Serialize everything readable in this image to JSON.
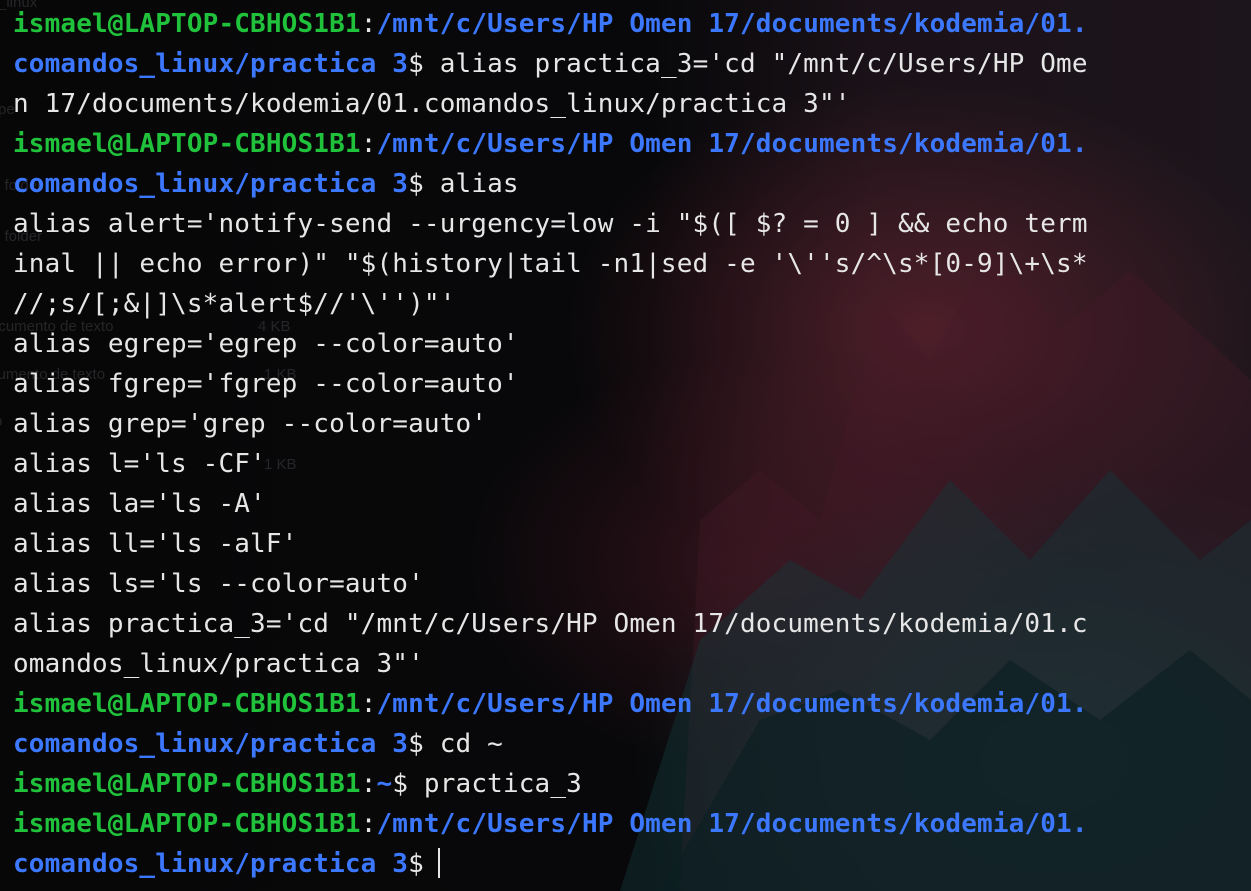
{
  "terminal": {
    "prompt": {
      "user_host": "ismael@LAPTOP-CBHOS1B1",
      "colon": ":",
      "dollar": "$"
    },
    "lines": [
      {
        "kind": "prompt",
        "path": "/mnt/c/Users/HP Omen 17/documents/kodemia/01."
      },
      {
        "kind": "prompt-cont",
        "path": "comandos_linux/practica 3",
        "command": " alias practica_3='cd \"/mnt/c/Users/HP Ome"
      },
      {
        "kind": "output",
        "text": "n 17/documents/kodemia/01.comandos_linux/practica 3\"'"
      },
      {
        "kind": "prompt",
        "path": "/mnt/c/Users/HP Omen 17/documents/kodemia/01."
      },
      {
        "kind": "prompt-cont",
        "path": "comandos_linux/practica 3",
        "command": " alias"
      },
      {
        "kind": "output",
        "text": "alias alert='notify-send --urgency=low -i \"$([ $? = 0 ] && echo term"
      },
      {
        "kind": "output",
        "text": "inal || echo error)\" \"$(history|tail -n1|sed -e '\\''s/^\\s*[0-9]\\+\\s*"
      },
      {
        "kind": "output",
        "text": "//;s/[;&|]\\s*alert$//'\\'')\"'"
      },
      {
        "kind": "output",
        "text": "alias egrep='egrep --color=auto'"
      },
      {
        "kind": "output",
        "text": "alias fgrep='fgrep --color=auto'"
      },
      {
        "kind": "output",
        "text": "alias grep='grep --color=auto'"
      },
      {
        "kind": "output",
        "text": "alias l='ls -CF'"
      },
      {
        "kind": "output",
        "text": "alias la='ls -A'"
      },
      {
        "kind": "output",
        "text": "alias ll='ls -alF'"
      },
      {
        "kind": "output",
        "text": "alias ls='ls --color=auto'"
      },
      {
        "kind": "output",
        "text": "alias practica_3='cd \"/mnt/c/Users/HP Omen 17/documents/kodemia/01.c"
      },
      {
        "kind": "output",
        "text": "omandos_linux/practica 3\"'"
      },
      {
        "kind": "prompt",
        "path": "/mnt/c/Users/HP Omen 17/documents/kodemia/01."
      },
      {
        "kind": "prompt-cont",
        "path": "comandos_linux/practica 3",
        "command": " cd ~"
      },
      {
        "kind": "prompt-inline",
        "path": "~",
        "command": " practica_3"
      },
      {
        "kind": "prompt",
        "path": "/mnt/c/Users/HP Omen 17/documents/kodemia/01."
      },
      {
        "kind": "prompt-cont",
        "path": "comandos_linux/practica 3",
        "command": ""
      }
    ]
  },
  "background_ghost_text": {
    "items": [
      "_linux",
      "pe",
      "e folder",
      "e folder",
      "ocumento de texto",
      "4 KB",
      "cumento de texto",
      "1 KB",
      "o",
      "1 KB"
    ]
  },
  "colors": {
    "background": "#0b0b0d",
    "text": "#e6e6e6",
    "user_host": "#1fc23a",
    "path": "#3b78ff"
  }
}
